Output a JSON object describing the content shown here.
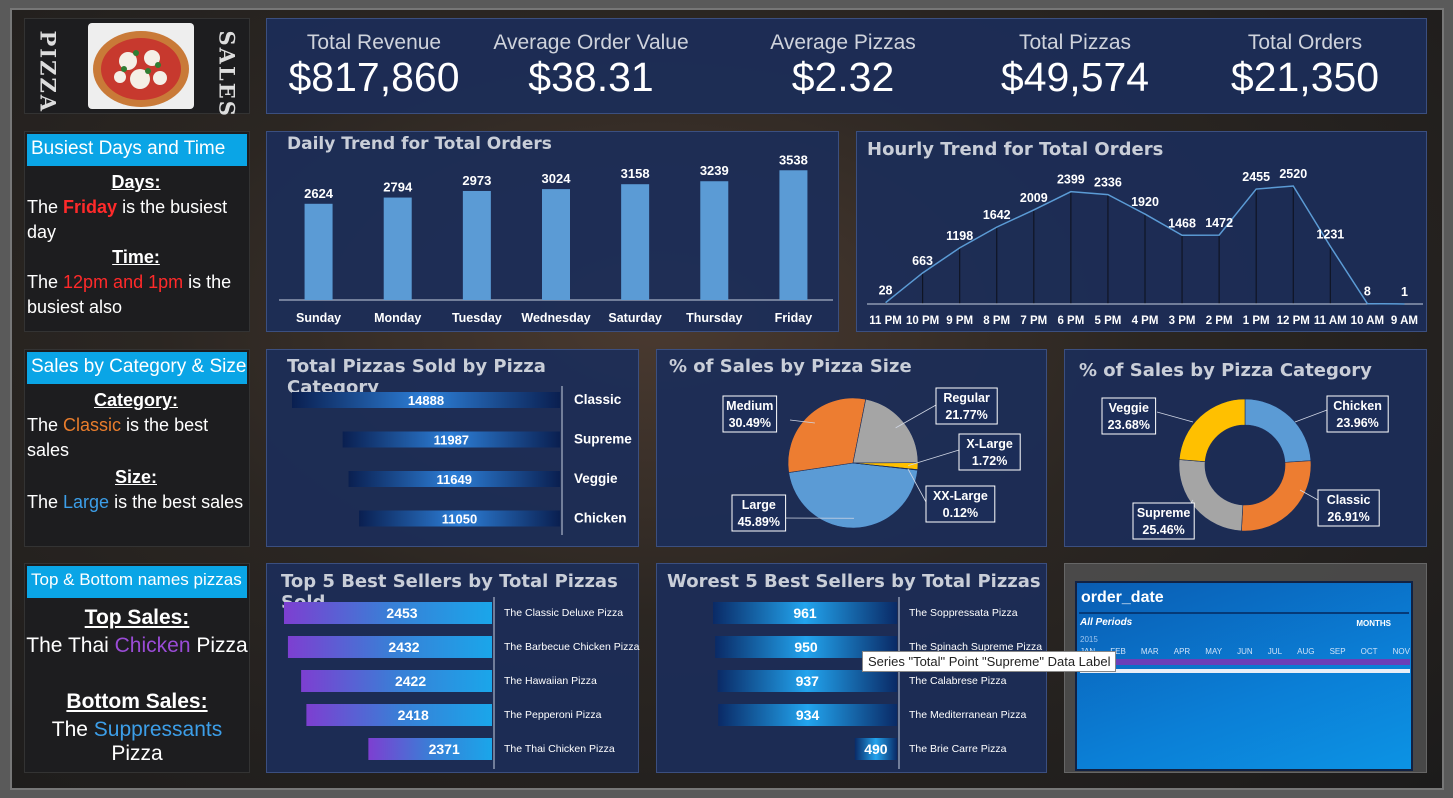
{
  "brand": {
    "left_word": "PIZZA",
    "right_word": "SALES"
  },
  "kpis": [
    {
      "label": "Total Revenue",
      "value": "$817,860"
    },
    {
      "label": "Average Order Value",
      "value": "$38.31"
    },
    {
      "label": "Average Pizzas",
      "value": "$2.32"
    },
    {
      "label": "Total Pizzas",
      "value": "$49,574"
    },
    {
      "label": "Total Orders",
      "value": "$21,350"
    }
  ],
  "busiest": {
    "title": "Busiest Days and Time",
    "days_label": "Days:",
    "days_pre": "The ",
    "days_hl": "Friday",
    "days_post": " is the busiest day",
    "time_label": "Time:",
    "time_pre": "The ",
    "time_hl": "12pm and 1pm",
    "time_post": " is the busiest also"
  },
  "catsize": {
    "title": "Sales by Category & Size",
    "cat_label": "Category:",
    "cat_pre": "The ",
    "cat_hl": "Classic",
    "cat_post": " is the best sales",
    "size_label": "Size:",
    "size_pre": "The ",
    "size_hl": "Large",
    "size_post": " is the best sales"
  },
  "topbottom": {
    "title": "Top & Bottom names pizzas",
    "top_label": "Top Sales:",
    "top_pre": "The Thai ",
    "top_hl": "Chicken",
    "top_post": " Pizza",
    "bottom_label": "Bottom Sales:",
    "bottom_pre": "The ",
    "bottom_hl": "Suppressants",
    "bottom_post": " Pizza"
  },
  "chart_data": [
    {
      "id": "daily",
      "type": "bar",
      "title": "Daily Trend for Total Orders",
      "categories": [
        "Sunday",
        "Monday",
        "Tuesday",
        "Wednesday",
        "Saturday",
        "Thursday",
        "Friday"
      ],
      "values": [
        2624,
        2794,
        2973,
        3024,
        3158,
        3239,
        3538
      ],
      "color": "#5b9bd5"
    },
    {
      "id": "hourly",
      "type": "line",
      "title": "Hourly Trend for Total Orders",
      "categories": [
        "11 PM",
        "10 PM",
        "9 PM",
        "8 PM",
        "7 PM",
        "6 PM",
        "5 PM",
        "4 PM",
        "3 PM",
        "2 PM",
        "1 PM",
        "12 PM",
        "11 AM",
        "10 AM",
        "9 AM"
      ],
      "values": [
        28,
        663,
        1198,
        1642,
        2009,
        2399,
        2336,
        1920,
        1468,
        1472,
        2455,
        2520,
        1231,
        8,
        1
      ],
      "color": "#5b9bd5"
    },
    {
      "id": "category",
      "type": "bar",
      "title": "Total Pizzas Sold by Pizza Category",
      "categories": [
        "Classic",
        "Supreme",
        "Veggie",
        "Chicken"
      ],
      "values": [
        14888,
        11987,
        11649,
        11050
      ]
    },
    {
      "id": "size",
      "type": "pie",
      "title": "% of Sales by Pizza Size",
      "labels": [
        "Large",
        "Medium",
        "Regular",
        "X-Large",
        "XX-Large"
      ],
      "values": [
        45.89,
        30.49,
        21.77,
        1.72,
        0.12
      ],
      "value_labels": [
        "45.89%",
        "30.49%",
        "21.77%",
        "1.72%",
        "0.12%"
      ],
      "colors": [
        "#5b9bd5",
        "#ed7d31",
        "#a5a5a5",
        "#ffc000",
        "#4472c4"
      ]
    },
    {
      "id": "pcat",
      "type": "pie",
      "title": "% of Sales by Pizza Category",
      "labels": [
        "Chicken",
        "Classic",
        "Supreme",
        "Veggie"
      ],
      "values": [
        23.96,
        26.91,
        25.46,
        23.68
      ],
      "value_labels": [
        "23.96%",
        "26.91%",
        "25.46%",
        "23.68%"
      ],
      "colors": [
        "#5b9bd5",
        "#ed7d31",
        "#a5a5a5",
        "#ffc000"
      ]
    },
    {
      "id": "top5",
      "type": "bar",
      "title": "Top 5 Best Sellers by Total Pizzas Sold",
      "categories": [
        "The Classic Deluxe Pizza",
        "The Barbecue Chicken Pizza",
        "The Hawaiian Pizza",
        "The Pepperoni Pizza",
        "The Thai Chicken Pizza"
      ],
      "values": [
        2453,
        2432,
        2422,
        2418,
        2371
      ]
    },
    {
      "id": "worst5",
      "type": "bar",
      "title": "Worest 5 Best Sellers by Total Pizzas",
      "categories": [
        "The Soppressata Pizza",
        "The Spinach Supreme Pizza",
        "The Calabrese Pizza",
        "The Mediterranean Pizza",
        "The Brie Carre Pizza"
      ],
      "values": [
        961,
        950,
        937,
        934,
        490
      ]
    }
  ],
  "tooltip": "Series \"Total\" Point \"Supreme\" Data Label",
  "slicer": {
    "title": "order_date",
    "periods": "All Periods",
    "unit": "MONTHS",
    "year": "2015",
    "months": [
      "JAN",
      "FEB",
      "MAR",
      "APR",
      "MAY",
      "JUN",
      "JUL",
      "AUG",
      "SEP",
      "OCT",
      "NOV"
    ]
  }
}
